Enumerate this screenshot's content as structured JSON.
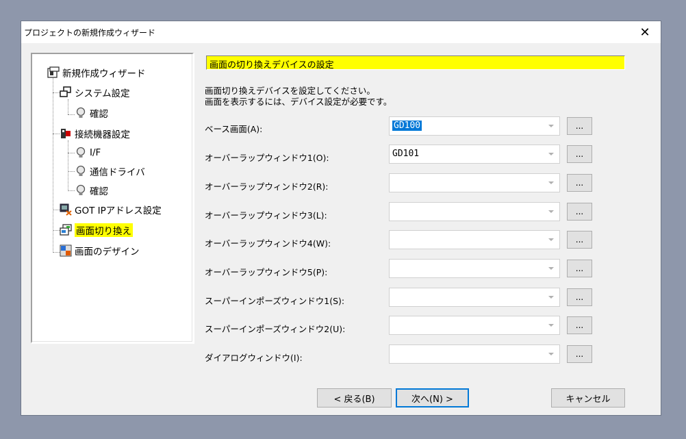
{
  "window": {
    "title": "プロジェクトの新規作成ウィザード",
    "close_glyph": "✕"
  },
  "tree": {
    "items": [
      {
        "label": "新規作成ウィザード"
      },
      {
        "label": "システム設定"
      },
      {
        "label": "確認"
      },
      {
        "label": "接続機器設定"
      },
      {
        "label": "I/F"
      },
      {
        "label": "通信ドライバ"
      },
      {
        "label": "確認"
      },
      {
        "label": "GOT IPアドレス設定"
      },
      {
        "label": "画面切り換え"
      },
      {
        "label": "画面のデザイン"
      }
    ]
  },
  "header": {
    "title": "画面の切り換えデバイスの設定"
  },
  "description": {
    "line1": "画面切り換えデバイスを設定してください。",
    "line2": "画面を表示するには、デバイス設定が必要です。"
  },
  "fields": [
    {
      "label": "ベース画面(A):",
      "value": "GD100"
    },
    {
      "label": "オーバーラップウィンドウ1(O):",
      "value": "GD101"
    },
    {
      "label": "オーバーラップウィンドウ2(R):",
      "value": ""
    },
    {
      "label": "オーバーラップウィンドウ3(L):",
      "value": ""
    },
    {
      "label": "オーバーラップウィンドウ4(W):",
      "value": ""
    },
    {
      "label": "オーバーラップウィンドウ5(P):",
      "value": ""
    },
    {
      "label": "スーパーインポーズウィンドウ1(S):",
      "value": ""
    },
    {
      "label": "スーパーインポーズウィンドウ2(U):",
      "value": ""
    },
    {
      "label": "ダイアログウィンドウ(I):",
      "value": ""
    }
  ],
  "browse_label": "...",
  "buttons": {
    "back": "< 戻る(B)",
    "next": "次へ(N) >",
    "cancel": "キャンセル"
  },
  "colors": {
    "highlight": "#ffff00",
    "selection": "#0078d7",
    "default_button_border": "#0078d7"
  }
}
